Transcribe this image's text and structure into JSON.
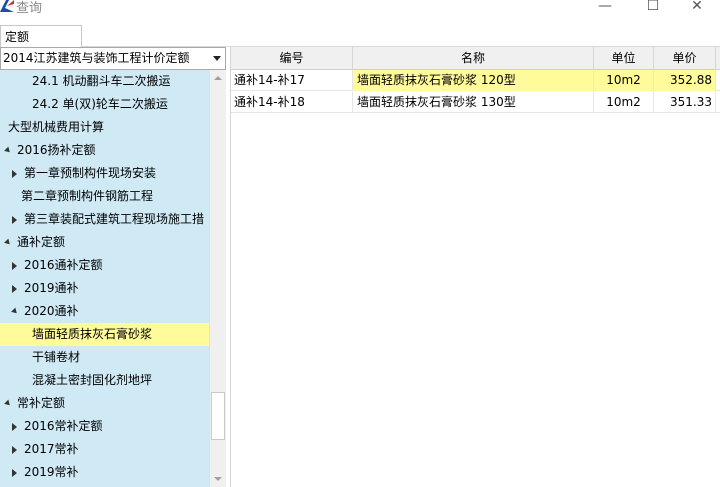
{
  "window": {
    "title": "查询",
    "minimize": "—",
    "maximize": "☐",
    "close": "✕"
  },
  "tab": {
    "label": "定额"
  },
  "library_select": {
    "value": "2014江苏建筑与装饰工程计价定额"
  },
  "tree": [
    {
      "label": "24.1 机动翻斗车二次搬运",
      "level": 2,
      "expander": "none"
    },
    {
      "label": "24.2 单(双)轮车二次搬运",
      "level": 2,
      "expander": "none"
    },
    {
      "label": "大型机械费用计算",
      "level": 0,
      "expander": "none"
    },
    {
      "label": "2016扬补定额",
      "level": 0,
      "expander": "expanded"
    },
    {
      "label": "第一章预制构件现场安装",
      "level": 1,
      "expander": "collapsed"
    },
    {
      "label": "第二章预制构件钢筋工程",
      "level": 1,
      "expander": "none"
    },
    {
      "label": "第三章装配式建筑工程现场施工措",
      "level": 1,
      "expander": "collapsed"
    },
    {
      "label": "通补定额",
      "level": 0,
      "expander": "expanded"
    },
    {
      "label": "2016通补定额",
      "level": 1,
      "expander": "collapsed"
    },
    {
      "label": "2019通补",
      "level": 1,
      "expander": "collapsed"
    },
    {
      "label": "2020通补",
      "level": 1,
      "expander": "expanded"
    },
    {
      "label": "墙面轻质抹灰石膏砂浆",
      "level": 2,
      "expander": "none",
      "selected": true
    },
    {
      "label": "干铺卷材",
      "level": 2,
      "expander": "none"
    },
    {
      "label": "混凝土密封固化剂地坪",
      "level": 2,
      "expander": "none"
    },
    {
      "label": "常补定额",
      "level": 0,
      "expander": "expanded"
    },
    {
      "label": "2016常补定额",
      "level": 1,
      "expander": "collapsed"
    },
    {
      "label": "2017常补",
      "level": 1,
      "expander": "collapsed"
    },
    {
      "label": "2019常补",
      "level": 1,
      "expander": "collapsed"
    }
  ],
  "table": {
    "columns": {
      "code": "编号",
      "name": "名称",
      "unit": "单位",
      "price": "单价"
    },
    "rows": [
      {
        "code": "通补14-补17",
        "name": "墙面轻质抹灰石膏砂浆 120型",
        "unit": "10m2",
        "price": "352.88",
        "selected": true
      },
      {
        "code": "通补14-补18",
        "name": "墙面轻质抹灰石膏砂浆 130型",
        "unit": "10m2",
        "price": "351.33",
        "selected": false
      }
    ]
  },
  "colors": {
    "tree_background": "#cfe9f5",
    "selection_highlight": "#fffa9a",
    "app_icon": "#1a4fa3"
  }
}
